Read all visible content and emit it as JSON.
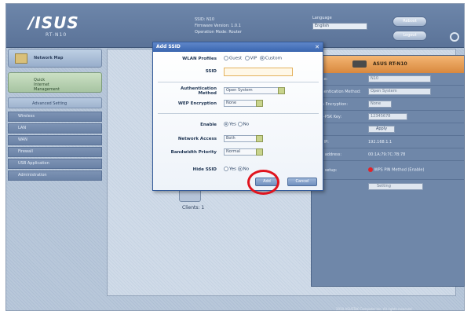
{
  "header": {
    "logo": "/ISUS",
    "logo_sub": "RT-N10",
    "info_line1": "SSID: N10",
    "info_line2": "Firmware Version: 1.0.1",
    "info_line3": "Operation Mode: Router",
    "language_label": "Language",
    "language_value": "English",
    "reboot_button": "Reboot",
    "logout_button": "Logout"
  },
  "sidebar": {
    "network_map": "Network Map",
    "eza_line1": "Quick",
    "eza_line2": "Internet",
    "eza_line3": "Management",
    "advanced": "Advanced Setting",
    "items": [
      "Wireless",
      "LAN",
      "WAN",
      "Firewall",
      "USB Application",
      "Administration"
    ]
  },
  "right_panel": {
    "title": "ASUS RT-N10",
    "rows": [
      {
        "k": "Name:",
        "v": "N10"
      },
      {
        "k": "Authentication Method:",
        "v": "Open System"
      },
      {
        "k": "Data Encryption:",
        "v": "None"
      },
      {
        "k": "WPA-PSK Key:",
        "v": "12345678"
      },
      {
        "k": "",
        "v": "Apply"
      },
      {
        "k": "LAN IP:",
        "v": "192.168.1.1"
      },
      {
        "k": "MAC address:",
        "v": "00:1A:79:7C:7B:78"
      },
      {
        "k": "WPS setup:",
        "v": "WPS PIN Method (Enable)"
      },
      {
        "k": "",
        "v": "Setting"
      }
    ]
  },
  "client": {
    "label": "Clients: 1"
  },
  "footer": "2010 ASUSTeK Computer Inc. All rights reserved.",
  "dialog": {
    "title": "Add SSID",
    "close": "✕",
    "wlan_profiles_label": "WLAN Profiles",
    "profile_options": [
      "Guest",
      "VIP",
      "Custom"
    ],
    "ssid_label": "SSID",
    "ssid_value": "",
    "auth_label_1": "Authentication",
    "auth_label_2": "Method",
    "auth_value": "Open System",
    "wep_label": "WEP Encryption",
    "wep_value": "None",
    "enable_label": "Enable",
    "enable_options": [
      "Yes",
      "No"
    ],
    "network_access_label": "Network Access",
    "network_access_value": "Both",
    "bandwidth_label": "Bandwidth Priority",
    "bandwidth_value": "Normal",
    "hide_ssid_label": "Hide SSID",
    "hide_ssid_options": [
      "Yes",
      "No"
    ],
    "add_button": "Add",
    "cancel_button": "Cancel"
  },
  "colors": {
    "highlight_ring": "#e0141e",
    "title_bar": "#3a66b0",
    "router_header": "#d8883e"
  }
}
